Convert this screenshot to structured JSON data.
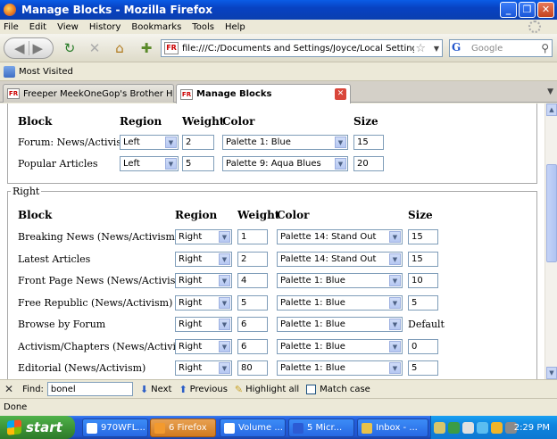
{
  "window": {
    "title": "Manage Blocks - Mozilla Firefox"
  },
  "menu": [
    "File",
    "Edit",
    "View",
    "History",
    "Bookmarks",
    "Tools",
    "Help"
  ],
  "nav": {
    "url": "file:///C:/Documents and Settings/Joyce/Local Settings/FREEPERS - f",
    "search_placeholder": "Google",
    "site_badge": "FR"
  },
  "bookmarks": {
    "most_visited": "Most Visited"
  },
  "tabs": [
    {
      "label": "Freeper MeekOneGop's Brother Has Pa..."
    },
    {
      "label": "Manage Blocks"
    }
  ],
  "blocks": {
    "headers": {
      "block": "Block",
      "region": "Region",
      "weight": "Weight",
      "color": "Color",
      "size": "Size"
    },
    "top_rows": [
      {
        "block": "Forum: News/Activism",
        "region": "Left",
        "weight": "2",
        "color": "Palette 1: Blue",
        "size": "15"
      },
      {
        "block": "Popular Articles",
        "region": "Left",
        "weight": "5",
        "color": "Palette 9: Aqua Blues",
        "size": "20"
      }
    ],
    "right_legend": "Right",
    "right_rows": [
      {
        "block": "Breaking News (News/Activism)",
        "region": "Right",
        "weight": "1",
        "color": "Palette 14: Stand Out",
        "size": "15"
      },
      {
        "block": "Latest Articles",
        "region": "Right",
        "weight": "2",
        "color": "Palette 14: Stand Out",
        "size": "15"
      },
      {
        "block": "Front Page News (News/Activism)",
        "region": "Right",
        "weight": "4",
        "color": "Palette 1: Blue",
        "size": "10"
      },
      {
        "block": "Free Republic (News/Activism)",
        "region": "Right",
        "weight": "5",
        "color": "Palette 1: Blue",
        "size": "5"
      },
      {
        "block": "Browse by Forum",
        "region": "Right",
        "weight": "6",
        "color": "Palette 1: Blue",
        "size": "Default"
      },
      {
        "block": "Activism/Chapters (News/Activism)",
        "region": "Right",
        "weight": "6",
        "color": "Palette 1: Blue",
        "size": "0"
      },
      {
        "block": "Editorial (News/Activism)",
        "region": "Right",
        "weight": "80",
        "color": "Palette 1: Blue",
        "size": "5"
      }
    ]
  },
  "findbar": {
    "label": "Find:",
    "value": "bonel",
    "next": "Next",
    "previous": "Previous",
    "highlight": "Highlight all",
    "match_case": "Match case"
  },
  "status": "Done",
  "taskbar": {
    "start": "start",
    "tasks": [
      {
        "label": "970WFL..."
      },
      {
        "label": "6 Firefox"
      },
      {
        "label": "Volume ..."
      },
      {
        "label": "5 Micr..."
      },
      {
        "label": "Inbox - ..."
      }
    ],
    "clock": "2:29 PM"
  }
}
